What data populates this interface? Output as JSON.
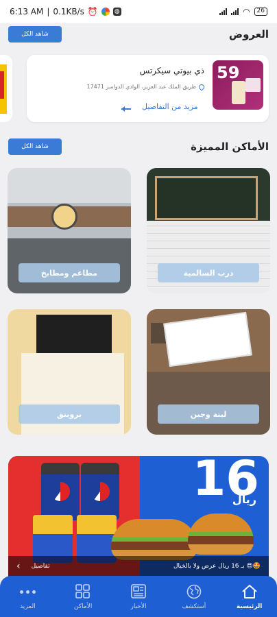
{
  "status_bar": {
    "time": "6:13 AM",
    "speed": "0.1KB/s",
    "battery": "26"
  },
  "offers": {
    "title": "العروض",
    "see_all": "شاهد الكل",
    "card": {
      "image_text": "59",
      "name": "ذي بيوتي سيكرتس",
      "address": "طريق الملك عبد العزيز، الوادي الدواسر 17471",
      "more_link": "مزيد من التفاصيل"
    }
  },
  "featured": {
    "title": "الأماكن المميزة",
    "see_all": "شاهد الكل",
    "places": [
      "مطاعم ومطابخ",
      "درب السالمية",
      "بروينق",
      "لبنة وجبن"
    ]
  },
  "ad": {
    "price": "16",
    "currency": "ريال",
    "caption": "بـ 16 ريال عرض ولا بالخيال 😍🤩",
    "details": "تفاصيل"
  },
  "nav": {
    "items": [
      "المزيد",
      "الأماكن",
      "الأخبار",
      "أستكشف",
      "الرئيسية"
    ],
    "active": "الرئيسية"
  },
  "colors": {
    "primary": "#1e60d4",
    "accent": "#3a7bd5",
    "promo_red": "#e52f2f"
  }
}
